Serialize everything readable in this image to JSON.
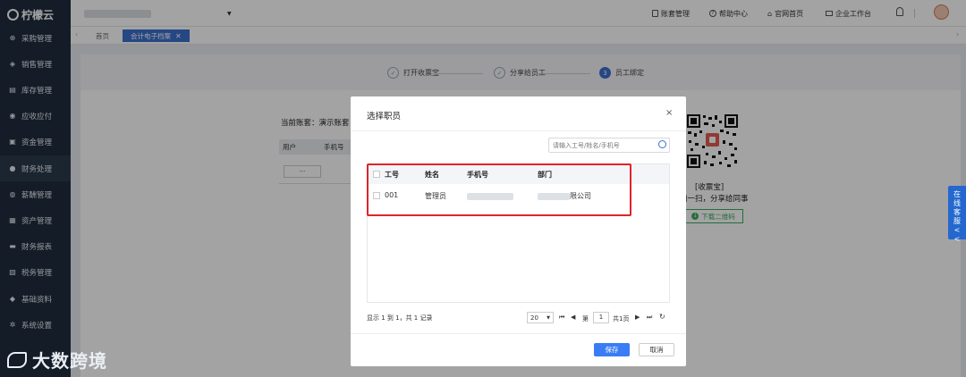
{
  "app": {
    "logo_text": "柠檬云"
  },
  "sidebar": {
    "items": [
      {
        "label": "采购管理",
        "icon": "cart-icon"
      },
      {
        "label": "销售管理",
        "icon": "tag-icon"
      },
      {
        "label": "库存管理",
        "icon": "warehouse-icon"
      },
      {
        "label": "应收应付",
        "icon": "exchange-icon"
      },
      {
        "label": "资金管理",
        "icon": "money-icon"
      },
      {
        "label": "财务处理",
        "icon": "finance-icon",
        "active": true
      },
      {
        "label": "薪酬管理",
        "icon": "user-icon"
      },
      {
        "label": "资产管理",
        "icon": "asset-icon"
      },
      {
        "label": "财务报表",
        "icon": "report-icon"
      },
      {
        "label": "税务管理",
        "icon": "tax-icon"
      },
      {
        "label": "基础资料",
        "icon": "data-icon"
      },
      {
        "label": "系统设置",
        "icon": "settings-icon"
      }
    ]
  },
  "topbar": {
    "account_manage": "账套管理",
    "help_center": "帮助中心",
    "official_home": "官网首页",
    "enterprise_workbench": "企业工作台"
  },
  "tabs": {
    "home": "首页",
    "active": "会计电子档案"
  },
  "steps": [
    {
      "num": "✓",
      "label": "打开收票宝",
      "state": "done"
    },
    {
      "num": "✓",
      "label": "分享给员工",
      "state": "done"
    },
    {
      "num": "3",
      "label": "员工绑定",
      "state": "active"
    }
  ],
  "page": {
    "current_account_label": "当前账套：演示账套",
    "bg_table_headers": [
      "用户",
      "手机号"
    ],
    "bg_dots": "···",
    "qr_caption": "[收票宝]",
    "qr_subcaption": "扫一扫，分享给同事",
    "download_qr": "下载二维码"
  },
  "modal": {
    "title": "选择职员",
    "search_placeholder": "请输入工号/姓名/手机号",
    "columns": [
      "工号",
      "姓名",
      "手机号",
      "部门"
    ],
    "rows": [
      {
        "id": "001",
        "name": "管理员",
        "phone": "",
        "dept_suffix": "限公司"
      }
    ],
    "pagination": {
      "summary": "显示 1 到 1，共 1 记录",
      "page_size": "20",
      "page_prefix": "第",
      "page_value": "1",
      "page_suffix": "共1页"
    },
    "save": "保存",
    "cancel": "取消"
  },
  "side_tab": {
    "text": "在线客服<<"
  },
  "watermark": {
    "text": "大数跨境"
  },
  "colors": {
    "primary": "#3a6fcf",
    "sidebar": "#1f2d3d",
    "highlight_box": "#e0232b"
  }
}
